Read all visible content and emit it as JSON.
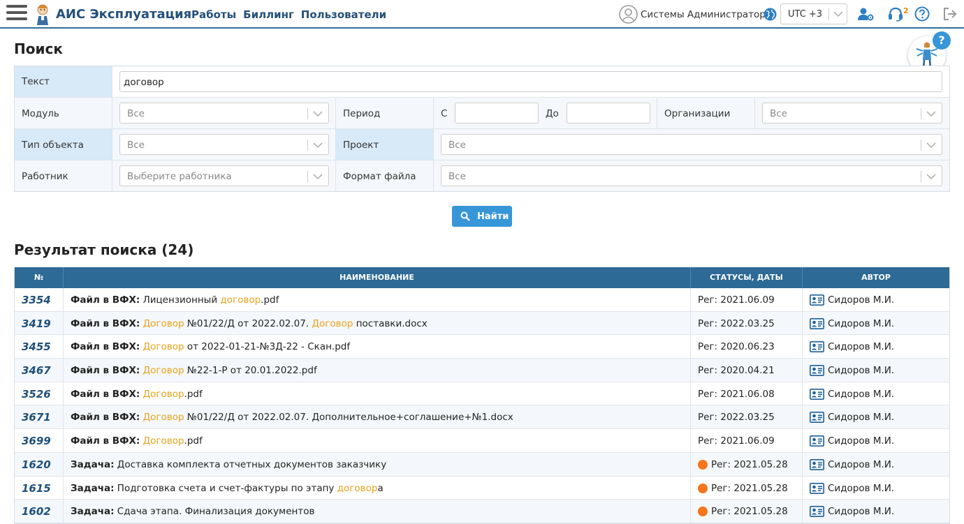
{
  "header": {
    "app_title": "АИС Эксплуатация",
    "nav": [
      "Работы",
      "Биллинг",
      "Пользователи"
    ],
    "user_name": "Системы Администратор",
    "timezone": "UTC +3",
    "support_badge": "2",
    "icons": [
      "menu-icon",
      "user-circle-icon",
      "globe-icon",
      "users-settings-icon",
      "headset-icon",
      "help-icon",
      "logout-icon"
    ]
  },
  "helper": {
    "question": "?"
  },
  "search": {
    "title": "Поиск",
    "text_label": "Текст",
    "text_value": "договор",
    "module_label": "Модуль",
    "module_value": "Все",
    "period_label": "Период",
    "period_from_label": "С",
    "period_to_label": "До",
    "period_from": "",
    "period_to": "",
    "org_label": "Организации",
    "org_value": "Все",
    "object_type_label": "Тип объекта",
    "object_type_value": "Все",
    "project_label": "Проект",
    "project_value": "Все",
    "worker_label": "Работник",
    "worker_placeholder": "Выберите работника",
    "file_format_label": "Формат файла",
    "file_format_value": "Все",
    "find_button": "Найти"
  },
  "results": {
    "title": "Результат поиска (24)",
    "columns": [
      "№",
      "НАИМЕНОВАНИЕ",
      "СТАТУСЫ, ДАТЫ",
      "АВТОР"
    ],
    "rows": [
      {
        "num": "3354",
        "kind": "Файл в ВФХ:",
        "parts": [
          " Лицензионный ",
          "договор",
          ".pdf"
        ],
        "status": "Рег: 2021.06.09",
        "dot": false,
        "author": "Сидоров М.И."
      },
      {
        "num": "3419",
        "kind": "Файл в ВФХ:",
        "parts": [
          " ",
          "Договор",
          " №01/22/Д от 2022.02.07. ",
          "Договор",
          " поставки.docx"
        ],
        "status": "Рег: 2022.03.25",
        "dot": false,
        "author": "Сидоров М.И."
      },
      {
        "num": "3455",
        "kind": "Файл в ВФХ:",
        "parts": [
          " ",
          "Договор",
          " от 2022-01-21-№3Д-22 - Скан.pdf"
        ],
        "status": "Рег: 2020.06.23",
        "dot": false,
        "author": "Сидоров М.И."
      },
      {
        "num": "3467",
        "kind": "Файл в ВФХ:",
        "parts": [
          " ",
          "Договор",
          " №22-1-Р от 20.01.2022.pdf"
        ],
        "status": "Рег: 2020.04.21",
        "dot": false,
        "author": "Сидоров М.И."
      },
      {
        "num": "3526",
        "kind": "Файл в ВФХ:",
        "parts": [
          " ",
          "Договор",
          ".pdf"
        ],
        "status": "Рег: 2021.06.08",
        "dot": false,
        "author": "Сидоров М.И."
      },
      {
        "num": "3671",
        "kind": "Файл в ВФХ:",
        "parts": [
          " ",
          "Договор",
          " №01/22/Д от 2022.02.07. Дополнительное+соглашение+№1.docx"
        ],
        "status": "Рег: 2022.03.25",
        "dot": false,
        "author": "Сидоров М.И."
      },
      {
        "num": "3699",
        "kind": "Файл в ВФХ:",
        "parts": [
          " ",
          "Договор",
          ".pdf"
        ],
        "status": "Рег: 2021.06.09",
        "dot": false,
        "author": "Сидоров М.И."
      },
      {
        "num": "1620",
        "kind": "Задача:",
        "parts": [
          " Доставка комплекта отчетных документов заказчику"
        ],
        "status": "Рег: 2021.05.28",
        "dot": true,
        "author": "Сидоров М.И."
      },
      {
        "num": "1615",
        "kind": "Задача:",
        "parts": [
          " Подготовка счета и счет-фактуры по этапу ",
          "договор",
          "а"
        ],
        "status": "Рег: 2021.05.28",
        "dot": true,
        "author": "Сидоров М.И."
      },
      {
        "num": "1602",
        "kind": "Задача:",
        "parts": [
          " Сдача этапа. Финализация документов"
        ],
        "status": "Рег: 2021.05.28",
        "dot": true,
        "author": "Сидоров М.И."
      }
    ]
  }
}
